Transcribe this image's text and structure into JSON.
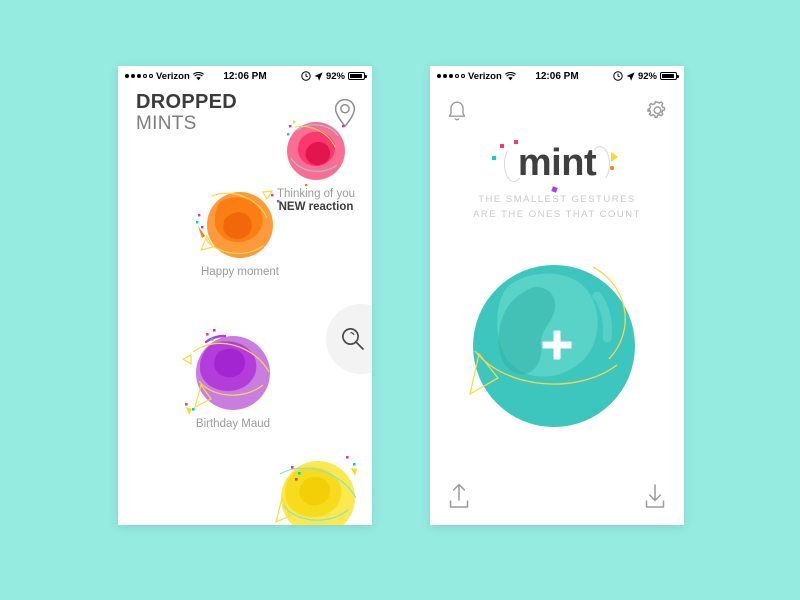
{
  "meta": {
    "background_color": "#95ebe0"
  },
  "status_bar": {
    "carrier": "Verizon",
    "time": "12:06 PM",
    "battery": "92%",
    "signal_dots_filled": 3,
    "signal_dots_empty": 2,
    "icons": [
      "wifi-icon",
      "alarm-icon",
      "location-arrow-icon",
      "battery-icon"
    ]
  },
  "left_screen": {
    "name": "dropped-mints",
    "title_line1": "DROPPED",
    "title_line2": "MINTS",
    "pin_button": "location-pin-icon",
    "search_button": "search-icon",
    "mints": [
      {
        "label": "Thinking of you",
        "sublabel": "NEW reaction",
        "color": "#f9386e",
        "color_light": "#fa6e96",
        "color_dark": "#e3154f"
      },
      {
        "label": "Happy moment",
        "sublabel": "",
        "color": "#fb7e14",
        "color_light": "#fd9b3c",
        "color_dark": "#f2670a"
      },
      {
        "label": "Birthday Maud",
        "sublabel": "",
        "color": "#b43cdb",
        "color_light": "#c97de0",
        "color_dark": "#a324d1"
      },
      {
        "label": "",
        "sublabel": "",
        "color": "#f7dc1e",
        "color_light": "#fbe94f",
        "color_dark": "#f2cf06"
      }
    ]
  },
  "right_screen": {
    "name": "mint-home",
    "bell_button": "bell-icon",
    "gear_button": "gear-icon",
    "logo": "mint",
    "tagline_line1": "THE SMALLEST GESTURES",
    "tagline_line2": "ARE THE ONES THAT COUNT",
    "drop_button": "plus-icon",
    "orb_color": "#3dc6bd",
    "orb_color_light": "#63d6cc",
    "orb_color_dark": "#31b3aa",
    "share_button": "upload-icon",
    "download_button": "download-icon"
  },
  "confetti_colors": [
    "#00d2c6",
    "#f9386e",
    "#b43cdb",
    "#f7dc1e",
    "#fb7e14"
  ]
}
